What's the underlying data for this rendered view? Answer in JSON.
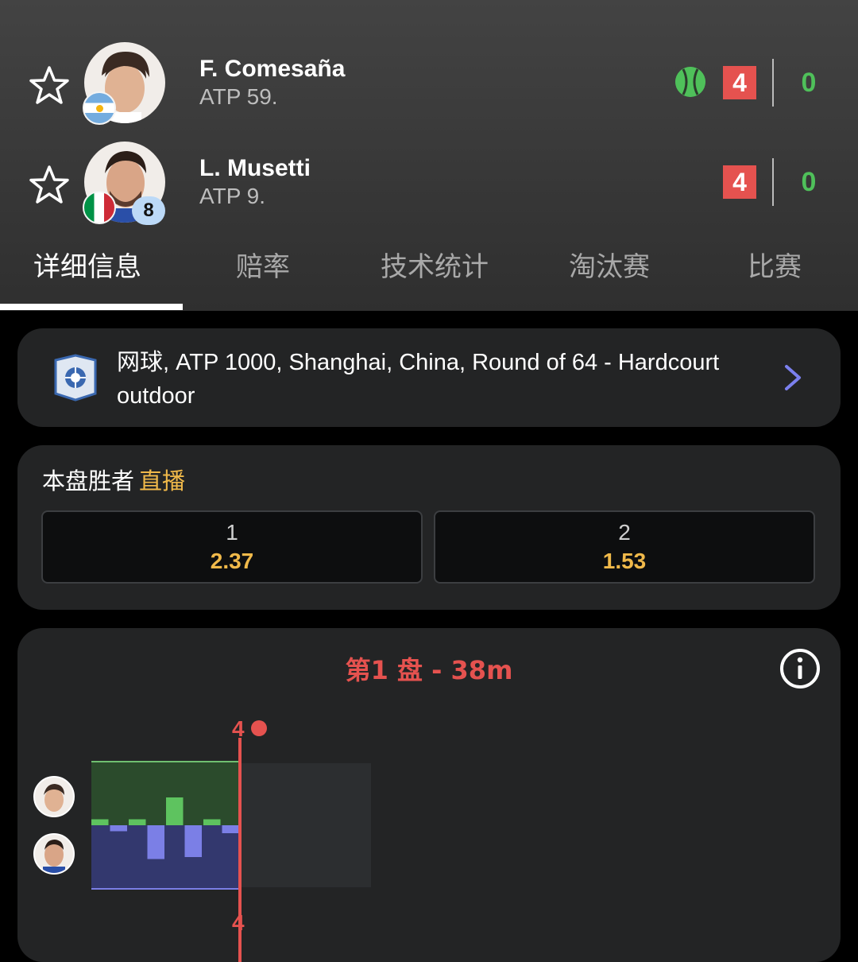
{
  "players": [
    {
      "name": "F. Comesaña",
      "rank": "ATP 59.",
      "flag": "argentina-flag",
      "seed": "",
      "serving": true,
      "games": "4",
      "sets": "0"
    },
    {
      "name": "L. Musetti",
      "rank": "ATP 9.",
      "flag": "italy-flag",
      "seed": "8",
      "serving": false,
      "games": "4",
      "sets": "0"
    }
  ],
  "tabs": [
    "详细信息",
    "赔率",
    "技术统计",
    "淘汰赛",
    "比赛"
  ],
  "active_tab": 0,
  "tournament": {
    "text": "网球, ATP 1000, Shanghai, China, Round of 64 - Hardcourt outdoor",
    "icon": "atp-shanghai-logo"
  },
  "odds": {
    "title": "本盘胜者",
    "live_label": "直播",
    "options": [
      {
        "label": "1",
        "value": "2.37"
      },
      {
        "label": "2",
        "value": "1.53"
      }
    ]
  },
  "timeline": {
    "title": "第1 盘 - 38m",
    "top_marker": "4",
    "bottom_marker": "4",
    "games": [
      0.3,
      -0.3,
      0.3,
      -1.7,
      1.4,
      -1.6,
      0.3,
      -0.4
    ],
    "colors": {
      "p1": "#5ec35f",
      "p2": "#7b7fe6",
      "marker": "#e5524f"
    }
  },
  "colors": {
    "accent": "#f0b94a",
    "score_red": "#e5524f",
    "serve_green": "#4fc05a"
  }
}
